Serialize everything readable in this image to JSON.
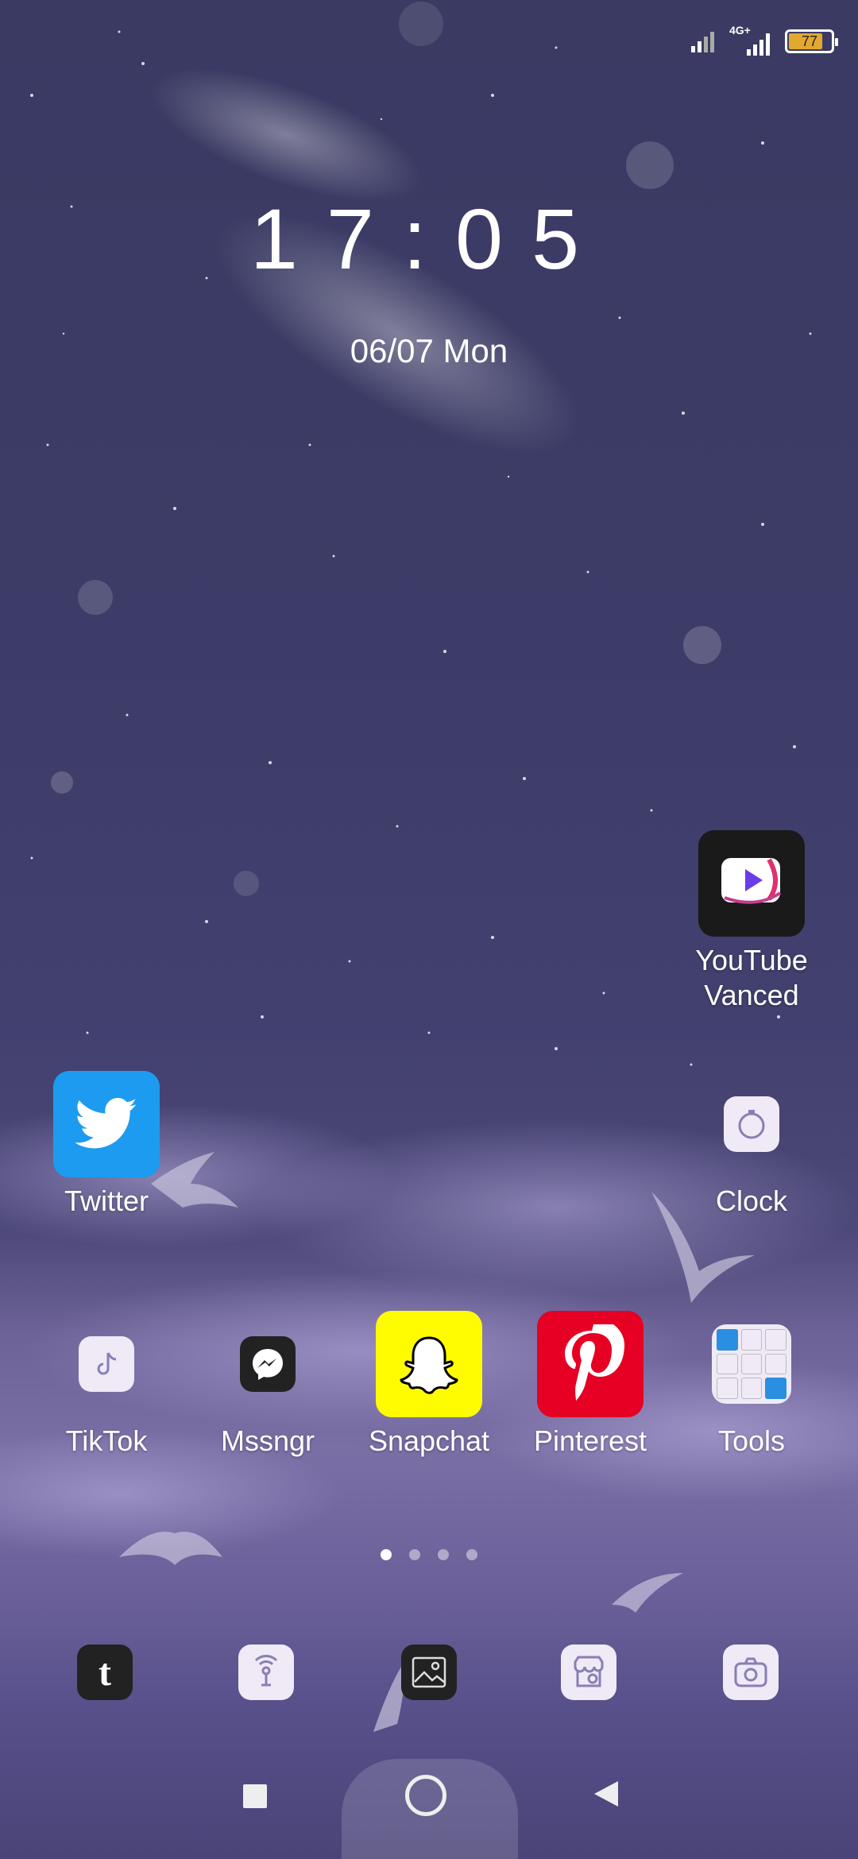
{
  "status_bar": {
    "network": "4G+",
    "battery_level": "77",
    "colors": {
      "battery_fill": "#e2a830"
    }
  },
  "lockscreen": {
    "time": "17:05",
    "date": "06/07 Mon"
  },
  "apps": {
    "youtube_vanced": "YouTube\nVanced",
    "twitter": "Twitter",
    "clock": "Clock",
    "tiktok": "TikTok",
    "messenger": "Mssngr",
    "snapchat": "Snapchat",
    "pinterest": "Pinterest",
    "tools": "Tools"
  },
  "page_indicator": {
    "pages": 4,
    "current": 1
  },
  "dock": [
    "tumblr-icon",
    "hotspot-icon",
    "gallery-icon",
    "app-store-icon",
    "camera-icon"
  ],
  "nav": [
    "recents-button",
    "home-button",
    "back-button"
  ],
  "colors": {
    "twitter": "#1d9bf0",
    "snapchat": "#fffc00",
    "pinterest": "#e60023",
    "youtube_vanced_bg": "#1a1a1a"
  }
}
